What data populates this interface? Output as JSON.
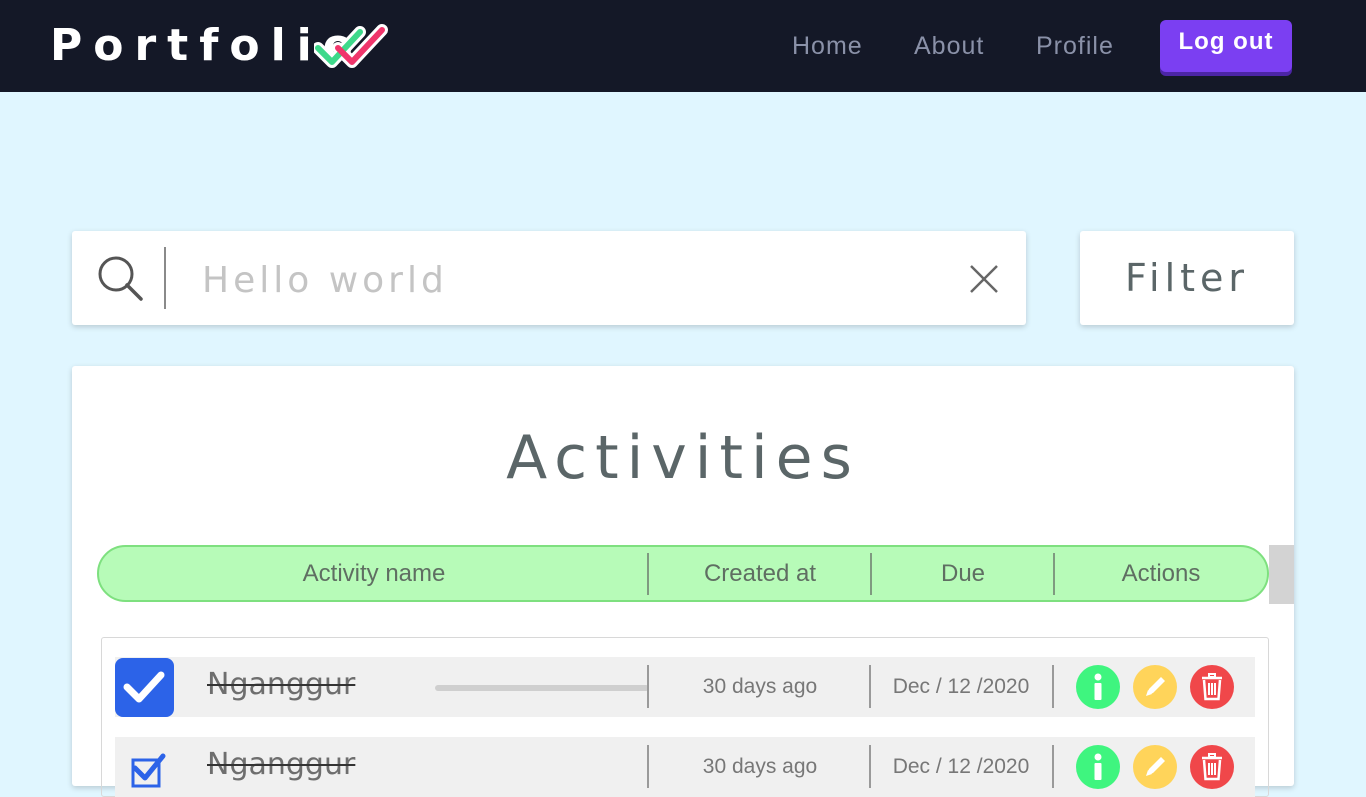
{
  "navbar": {
    "brand": "Portfolio",
    "links": [
      "Home",
      "About",
      "Profile"
    ],
    "logout_label": "Log out"
  },
  "search": {
    "placeholder": "Hello world",
    "value": "",
    "filter_label": "Filter"
  },
  "activities": {
    "title": "Activities",
    "columns": [
      "Activity name",
      "Created at",
      "Due",
      "Actions"
    ],
    "rows": [
      {
        "name": "Nganggur",
        "created": "30 days ago",
        "due": "Dec / 12 /2020",
        "done": true
      },
      {
        "name": "Nganggur",
        "created": "30 days ago",
        "due": "Dec / 12 /2020",
        "done": true
      }
    ]
  },
  "colors": {
    "navbar_bg": "#141827",
    "logout_bg": "#7b3ff2",
    "page_bg": "#e0f6ff",
    "header_bg": "#b7fbb8",
    "check_bg": "#2c63e8",
    "info": "#3ff57f",
    "edit": "#ffd45a",
    "delete": "#f0474a"
  },
  "icons": [
    "double-check-logo-icon",
    "search-icon",
    "close-icon",
    "checkbox-checked-icon",
    "info-icon",
    "pencil-icon",
    "trash-icon"
  ]
}
